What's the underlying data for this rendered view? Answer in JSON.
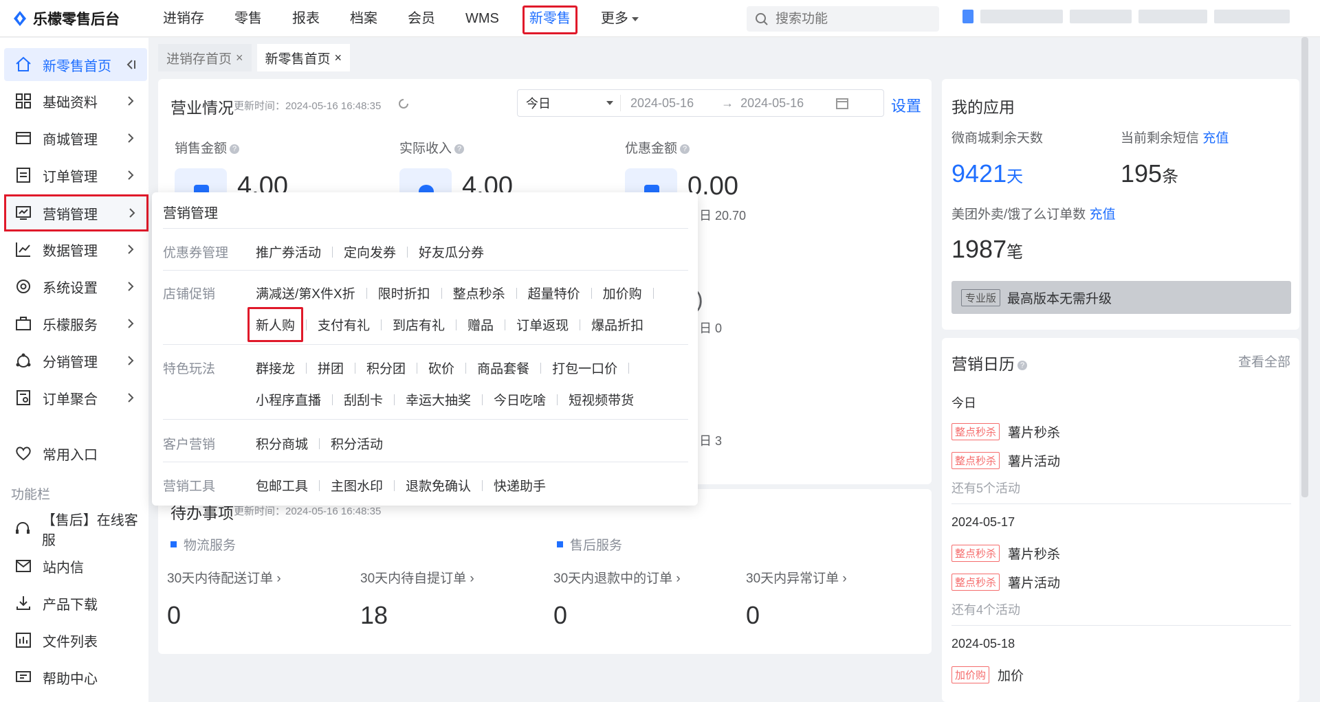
{
  "app": {
    "logo_text": "乐檬零售后台"
  },
  "topnav": {
    "items": [
      {
        "label": "进销存"
      },
      {
        "label": "零售"
      },
      {
        "label": "报表"
      },
      {
        "label": "档案"
      },
      {
        "label": "会员"
      },
      {
        "label": "WMS"
      },
      {
        "label": "新零售",
        "active": true
      },
      {
        "label": "更多"
      }
    ],
    "search_placeholder": "搜索功能"
  },
  "sidebar": {
    "items": [
      {
        "label": "新零售首页",
        "icon": "home-icon"
      },
      {
        "label": "基础资料",
        "icon": "grid-icon"
      },
      {
        "label": "商城管理",
        "icon": "store-icon"
      },
      {
        "label": "订单管理",
        "icon": "order-icon"
      },
      {
        "label": "营销管理",
        "icon": "marketing-icon"
      },
      {
        "label": "数据管理",
        "icon": "chart-icon"
      },
      {
        "label": "系统设置",
        "icon": "gear-icon"
      },
      {
        "label": "乐檬服务",
        "icon": "briefcase-icon"
      },
      {
        "label": "分销管理",
        "icon": "distribution-icon"
      },
      {
        "label": "订单聚合",
        "icon": "aggregate-icon"
      },
      {
        "label": "常用入口",
        "icon": "heart-icon"
      }
    ],
    "section_label": "功能栏",
    "tools": [
      {
        "label": "【售后】在线客服",
        "icon": "headset-icon"
      },
      {
        "label": "站内信",
        "icon": "mail-icon"
      },
      {
        "label": "产品下载",
        "icon": "download-icon"
      },
      {
        "label": "文件列表",
        "icon": "file-list-icon"
      },
      {
        "label": "帮助中心",
        "icon": "help-icon"
      }
    ]
  },
  "tabs": [
    {
      "label": "进销存首页",
      "close": "×"
    },
    {
      "label": "新零售首页",
      "close": "×"
    }
  ],
  "business": {
    "title": "营业情况",
    "update_time": "更新时间：2024-05-16 16:48:35",
    "range_select": "今日",
    "date_start": "2024-05-16",
    "date_sep": "→",
    "date_end": "2024-05-16",
    "settings": "设置",
    "metrics": [
      {
        "label": "销售金额",
        "value": "4.00"
      },
      {
        "label": "实际收入",
        "value": "4.00"
      },
      {
        "label": "优惠金额",
        "value": "0.00"
      }
    ],
    "partials": [
      "日 20.70",
      ")",
      "日 0",
      "日 3"
    ]
  },
  "dropdown": {
    "title": "营销管理",
    "categories": [
      {
        "name": "优惠券管理",
        "rows": [
          [
            "推广券活动",
            "定向发券",
            "好友瓜分券"
          ]
        ]
      },
      {
        "name": "店铺促销",
        "rows": [
          [
            "满减送/第X件X折",
            "限时折扣",
            "整点秒杀",
            "超量特价",
            "加价购"
          ],
          [
            "新人购",
            "支付有礼",
            "到店有礼",
            "赠品",
            "订单返现",
            "爆品折扣"
          ]
        ]
      },
      {
        "name": "特色玩法",
        "rows": [
          [
            "群接龙",
            "拼团",
            "积分团",
            "砍价",
            "商品套餐",
            "打包一口价"
          ],
          [
            "小程序直播",
            "刮刮卡",
            "幸运大抽奖",
            "今日吃啥",
            "短视频带货"
          ]
        ]
      },
      {
        "name": "客户营销",
        "rows": [
          [
            "积分商城",
            "积分活动"
          ]
        ]
      },
      {
        "name": "营销工具",
        "rows": [
          [
            "包邮工具",
            "主图水印",
            "退款免确认",
            "快递助手"
          ]
        ]
      }
    ]
  },
  "todo": {
    "title": "待办事项",
    "update_time": "更新时间：2024-05-16 16:48:35",
    "sections": [
      "物流服务",
      "售后服务"
    ],
    "items": [
      {
        "label": "30天内待配送订单 ›",
        "value": "0"
      },
      {
        "label": "30天内待自提订单 ›",
        "value": "18"
      },
      {
        "label": "30天内退款中的订单 ›",
        "value": "0"
      },
      {
        "label": "30天内异常订单 ›",
        "value": "0"
      }
    ]
  },
  "apps": {
    "title": "我的应用",
    "mall_days_label": "微商城剩余天数",
    "mall_days": "9421",
    "mall_days_unit": "天",
    "sms_label": "当前剩余短信",
    "sms_recharge": "充值",
    "sms_count": "195",
    "sms_unit": "条",
    "takeout_label": "美团外卖/饿了么订单数",
    "takeout_recharge": "充值",
    "takeout_count": "1987",
    "takeout_unit": "笔",
    "edition_tag": "专业版",
    "edition_text": "最高版本无需升级"
  },
  "calendar": {
    "title": "营销日历",
    "view_all": "查看全部",
    "days": [
      {
        "date": "今日",
        "items": [
          {
            "tag": "整点秒杀",
            "name": "薯片秒杀"
          },
          {
            "tag": "整点秒杀",
            "name": "薯片活动"
          }
        ],
        "more": "还有5个活动"
      },
      {
        "date": "2024-05-17",
        "items": [
          {
            "tag": "整点秒杀",
            "name": "薯片秒杀"
          },
          {
            "tag": "整点秒杀",
            "name": "薯片活动"
          }
        ],
        "more": "还有4个活动"
      },
      {
        "date": "2024-05-18",
        "items": [
          {
            "tag": "加价购",
            "name": "加价"
          }
        ]
      }
    ]
  },
  "colors": {
    "accent": "#1f6fff",
    "highlight": "#e0192a",
    "tag_red": "#f56c6c"
  }
}
